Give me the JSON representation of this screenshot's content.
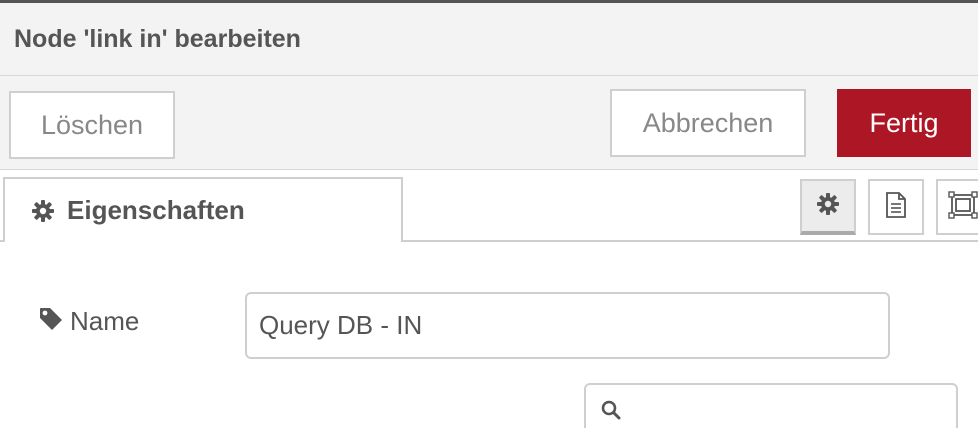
{
  "dialog": {
    "title": "Node 'link in' bearbeiten"
  },
  "toolbar": {
    "delete_label": "Löschen",
    "cancel_label": "Abbrechen",
    "done_label": "Fertig"
  },
  "tabs": {
    "properties_label": "Eigenschaften",
    "icon_tabs": [
      "gear-icon",
      "document-icon",
      "frame-icon"
    ]
  },
  "form": {
    "name_label": "Name",
    "name_value": "Query DB - IN",
    "search_placeholder": ""
  },
  "colors": {
    "primary_button": "#ad1625",
    "text": "#555555",
    "muted_text": "#888888",
    "border": "#cfcfcf",
    "header_bg": "#f3f3f3"
  }
}
